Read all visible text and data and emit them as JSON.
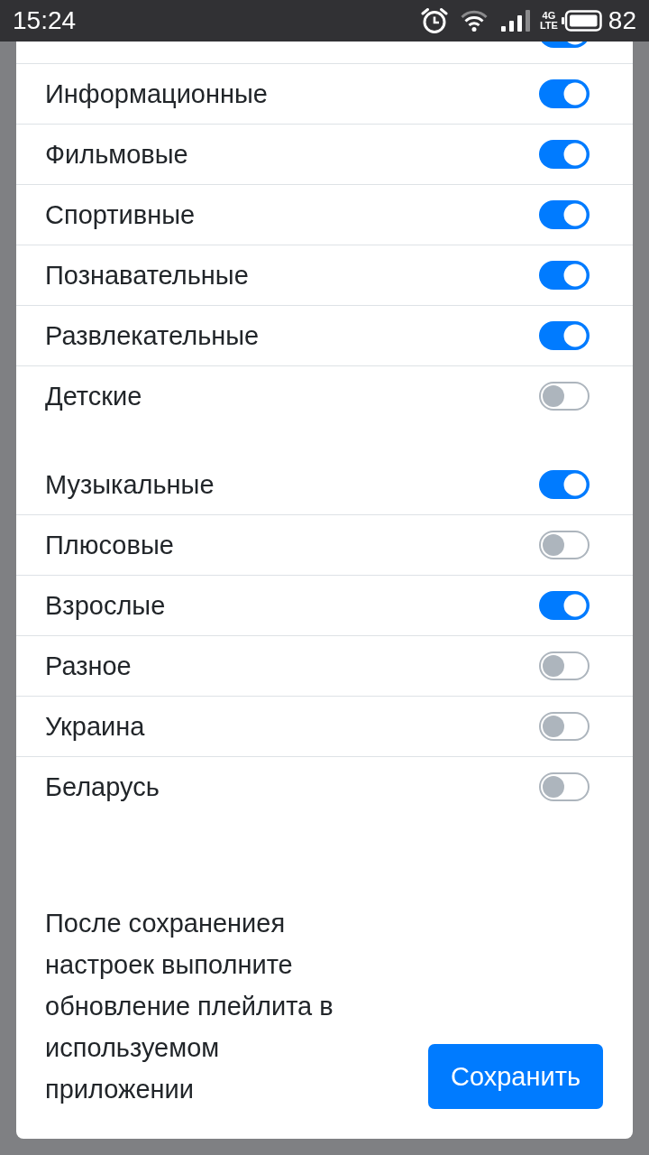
{
  "status_bar": {
    "time": "15:24",
    "network": [
      "4G",
      "LTE"
    ],
    "battery": "82"
  },
  "partial_row": {
    "on": true
  },
  "groups": [
    {
      "items": [
        {
          "label": "Информационные",
          "on": true
        },
        {
          "label": "Фильмовые",
          "on": true
        },
        {
          "label": "Спортивные",
          "on": true
        },
        {
          "label": "Познавательные",
          "on": true
        },
        {
          "label": "Развлекательные",
          "on": true
        },
        {
          "label": "Детские",
          "on": false
        }
      ]
    },
    {
      "items": [
        {
          "label": "Музыкальные",
          "on": true
        },
        {
          "label": "Плюсовые",
          "on": false
        },
        {
          "label": "Взрослые",
          "on": true
        },
        {
          "label": "Разное",
          "on": false
        },
        {
          "label": "Украина",
          "on": false
        },
        {
          "label": "Беларусь",
          "on": false
        }
      ]
    }
  ],
  "note": "После сохранениея настроек выполните обновление плейлита в используемом приложении",
  "save_button": "Сохранить"
}
